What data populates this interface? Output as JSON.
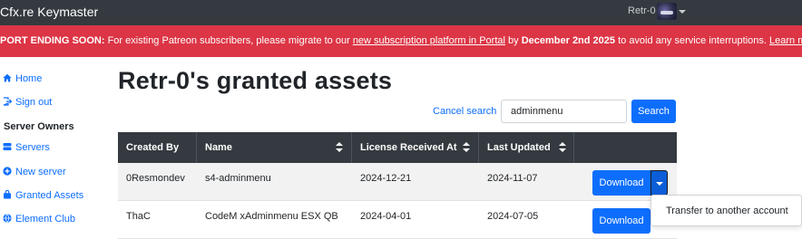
{
  "header": {
    "brand": "Cfx.re Keymaster",
    "username": "Retr-0",
    "avatar_icon": "user-avatar-icon"
  },
  "alert": {
    "prefix": "PORT ENDING SOON:",
    "text1": " For existing Patreon subscribers, please migrate to our ",
    "link1": "new subscription platform in Portal",
    "text2": " by ",
    "deadline": "December 2nd 2025",
    "text3": " to avoid any service interruptions. ",
    "link2": "Learn more",
    "end": "."
  },
  "sidebar": {
    "items": [
      {
        "label": "Home",
        "icon": "home-icon"
      },
      {
        "label": "Sign out",
        "icon": "sign-out-icon"
      },
      {
        "label": "Servers",
        "icon": "server-icon"
      },
      {
        "label": "New server",
        "icon": "plus-circle-icon"
      },
      {
        "label": "Granted Assets",
        "icon": "bag-icon"
      },
      {
        "label": "Element Club",
        "icon": "globe-icon"
      }
    ],
    "section_title": "Server Owners"
  },
  "main": {
    "title": "Retr-0's granted assets",
    "cancel_search": "Cancel search",
    "search_value": "adminmenu",
    "search_button": "Search"
  },
  "table": {
    "columns": [
      "Created By",
      "Name",
      "License Received At",
      "Last Updated",
      ""
    ],
    "rows": [
      {
        "created_by": "0Resmondev",
        "name": "s4-adminmenu",
        "license_received": "2024-12-21",
        "last_updated": "2024-11-07",
        "action": "Download"
      },
      {
        "created_by": "ThaC",
        "name": "CodeM xAdminmenu ESX QB",
        "license_received": "2024-04-01",
        "last_updated": "2024-07-05",
        "action": "Download"
      }
    ]
  },
  "dropdown": {
    "items": [
      "Transfer to another account"
    ]
  },
  "colors": {
    "topbar": "#343a40",
    "alert": "#dc3545",
    "primary": "#0d6efd",
    "table_header": "#343a40"
  }
}
